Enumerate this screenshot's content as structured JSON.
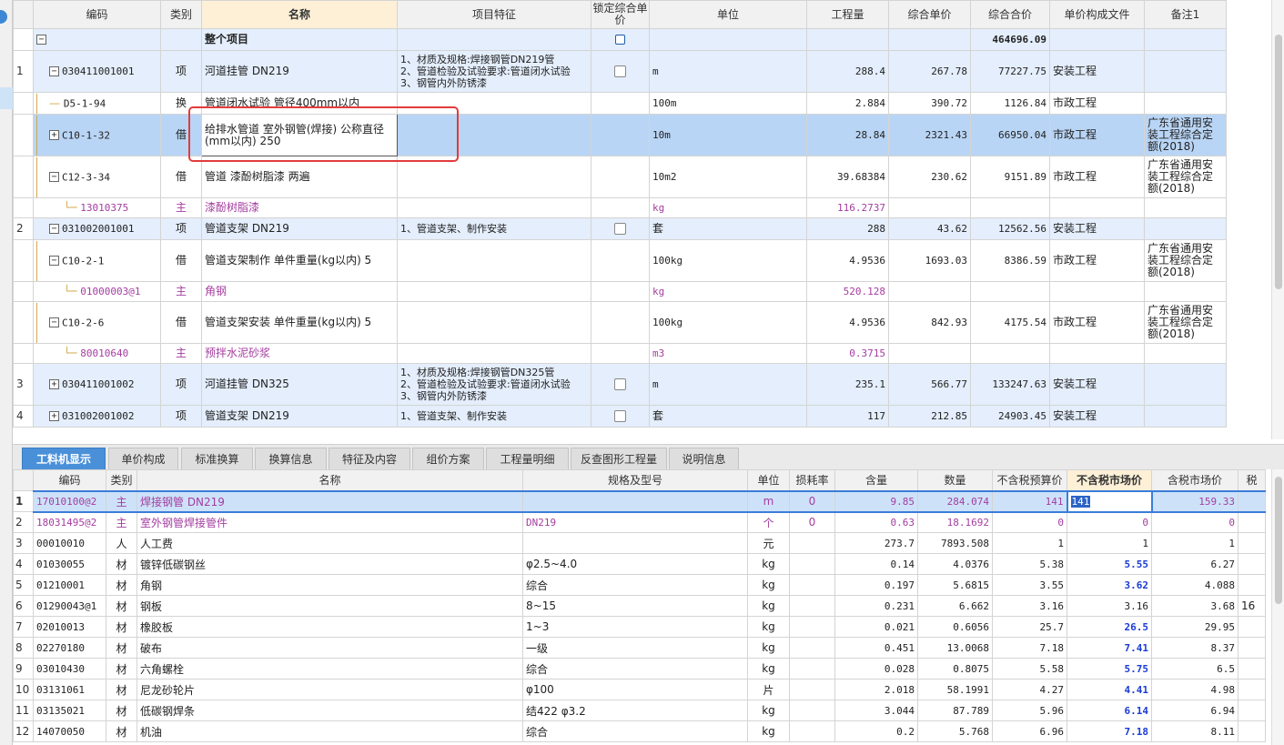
{
  "top": {
    "headers": [
      "",
      "编码",
      "类别",
      "名称",
      "项目特征",
      "锁定综合单价",
      "单位",
      "工程量",
      "综合单价",
      "综合合价",
      "单价构成文件",
      "备注1"
    ],
    "root": {
      "label": "整个项目",
      "total": "464696.09"
    },
    "rows": [
      {
        "no": "1",
        "code": "030411001001",
        "type": "项",
        "name": "河道挂管 DN219",
        "feat": [
          "1、材质及规格:焊接钢管DN219管",
          "2、管道检验及试验要求:管道闭水试验",
          "3、钢管内外防锈漆"
        ],
        "unit": "m",
        "qty": "288.4",
        "price": "267.78",
        "total": "77227.75",
        "file": "安装工程",
        "note": ""
      },
      {
        "no": "",
        "code": "D5-1-94",
        "type": "换",
        "name": "管道闭水试验 管径400mm以内",
        "feat": [],
        "unit": "100m",
        "qty": "2.884",
        "price": "390.72",
        "total": "1126.84",
        "file": "市政工程",
        "note": ""
      },
      {
        "no": "",
        "code": "C10-1-32",
        "type": "借",
        "name": "给排水管道 室外钢管(焊接) 公称直径(mm以内) 250",
        "feat": [],
        "unit": "10m",
        "qty": "28.84",
        "price": "2321.43",
        "total": "66950.04",
        "file": "市政工程",
        "note": "广东省通用安装工程综合定额(2018)"
      },
      {
        "no": "",
        "code": "C12-3-34",
        "type": "借",
        "name": "管道 漆酚树脂漆 两遍",
        "feat": [],
        "unit": "10m2",
        "qty": "39.68384",
        "price": "230.62",
        "total": "9151.89",
        "file": "市政工程",
        "note": "广东省通用安装工程综合定额(2018)"
      },
      {
        "no": "",
        "code": "13010375",
        "type": "主",
        "name": "漆酚树脂漆",
        "feat": [],
        "unit": "kg",
        "qty": "116.2737",
        "price": "",
        "total": "",
        "file": "",
        "note": ""
      },
      {
        "no": "2",
        "code": "031002001001",
        "type": "项",
        "name": "管道支架 DN219",
        "feat": [
          "1、管道支架、制作安装"
        ],
        "unit": "套",
        "qty": "288",
        "price": "43.62",
        "total": "12562.56",
        "file": "安装工程",
        "note": ""
      },
      {
        "no": "",
        "code": "C10-2-1",
        "type": "借",
        "name": "管道支架制作 单件重量(kg以内) 5",
        "feat": [],
        "unit": "100kg",
        "qty": "4.9536",
        "price": "1693.03",
        "total": "8386.59",
        "file": "市政工程",
        "note": "广东省通用安装工程综合定额(2018)"
      },
      {
        "no": "",
        "code": "01000003@1",
        "type": "主",
        "name": "角钢",
        "feat": [],
        "unit": "kg",
        "qty": "520.128",
        "price": "",
        "total": "",
        "file": "",
        "note": ""
      },
      {
        "no": "",
        "code": "C10-2-6",
        "type": "借",
        "name": "管道支架安装 单件重量(kg以内) 5",
        "feat": [],
        "unit": "100kg",
        "qty": "4.9536",
        "price": "842.93",
        "total": "4175.54",
        "file": "市政工程",
        "note": "广东省通用安装工程综合定额(2018)"
      },
      {
        "no": "",
        "code": "80010640",
        "type": "主",
        "name": "预拌水泥砂浆",
        "feat": [],
        "unit": "m3",
        "qty": "0.3715",
        "price": "",
        "total": "",
        "file": "",
        "note": ""
      },
      {
        "no": "3",
        "code": "030411001002",
        "type": "项",
        "name": "河道挂管 DN325",
        "feat": [
          "1、材质及规格:焊接钢管DN325管",
          "2、管道检验及试验要求:管道闭水试验",
          "3、钢管内外防锈漆"
        ],
        "unit": "m",
        "qty": "235.1",
        "price": "566.77",
        "total": "133247.63",
        "file": "安装工程",
        "note": ""
      },
      {
        "no": "4",
        "code": "031002001002",
        "type": "项",
        "name": "管道支架 DN219",
        "feat": [
          "1、管道支架、制作安装"
        ],
        "unit": "套",
        "qty": "117",
        "price": "212.85",
        "total": "24903.45",
        "file": "安装工程",
        "note": ""
      }
    ]
  },
  "tabs": [
    "工料机显示",
    "单价构成",
    "标准换算",
    "换算信息",
    "特征及内容",
    "组价方案",
    "工程量明细",
    "反查图形工程量",
    "说明信息"
  ],
  "bottom": {
    "headers": [
      "",
      "编码",
      "类别",
      "名称",
      "规格及型号",
      "单位",
      "损耗率",
      "含量",
      "数量",
      "不含税预算价",
      "不含税市场价",
      "含税市场价",
      "税"
    ],
    "rows": [
      {
        "no": "1",
        "code": "17010100@2",
        "type": "主",
        "name": "焊接钢管 DN219",
        "spec": "",
        "unit": "m",
        "loss": "0",
        "content": "9.85",
        "qty": "284.074",
        "budget": "141",
        "market": "141",
        "tax": "159.33",
        "extra": ""
      },
      {
        "no": "2",
        "code": "18031495@2",
        "type": "主",
        "name": "室外钢管焊接管件",
        "spec": "DN219",
        "unit": "个",
        "loss": "0",
        "content": "0.63",
        "qty": "18.1692",
        "budget": "0",
        "market": "0",
        "tax": "0",
        "extra": ""
      },
      {
        "no": "3",
        "code": "00010010",
        "type": "人",
        "name": "人工费",
        "spec": "",
        "unit": "元",
        "loss": "",
        "content": "273.7",
        "qty": "7893.508",
        "budget": "1",
        "market": "1",
        "tax": "1",
        "extra": ""
      },
      {
        "no": "4",
        "code": "01030055",
        "type": "材",
        "name": "镀锌低碳钢丝",
        "spec": "φ2.5~4.0",
        "unit": "kg",
        "loss": "",
        "content": "0.14",
        "qty": "4.0376",
        "budget": "5.38",
        "market": "5.55",
        "tax": "6.27",
        "extra": ""
      },
      {
        "no": "5",
        "code": "01210001",
        "type": "材",
        "name": "角钢",
        "spec": "综合",
        "unit": "kg",
        "loss": "",
        "content": "0.197",
        "qty": "5.6815",
        "budget": "3.55",
        "market": "3.62",
        "tax": "4.088",
        "extra": ""
      },
      {
        "no": "6",
        "code": "01290043@1",
        "type": "材",
        "name": "钢板",
        "spec": "8~15",
        "unit": "kg",
        "loss": "",
        "content": "0.231",
        "qty": "6.662",
        "budget": "3.16",
        "market": "3.16",
        "tax": "3.68",
        "extra": "16"
      },
      {
        "no": "7",
        "code": "02010013",
        "type": "材",
        "name": "橡胶板",
        "spec": "1~3",
        "unit": "kg",
        "loss": "",
        "content": "0.021",
        "qty": "0.6056",
        "budget": "25.7",
        "market": "26.5",
        "tax": "29.95",
        "extra": ""
      },
      {
        "no": "8",
        "code": "02270180",
        "type": "材",
        "name": "破布",
        "spec": "一级",
        "unit": "kg",
        "loss": "",
        "content": "0.451",
        "qty": "13.0068",
        "budget": "7.18",
        "market": "7.41",
        "tax": "8.37",
        "extra": ""
      },
      {
        "no": "9",
        "code": "03010430",
        "type": "材",
        "name": "六角螺栓",
        "spec": "综合",
        "unit": "kg",
        "loss": "",
        "content": "0.028",
        "qty": "0.8075",
        "budget": "5.58",
        "market": "5.75",
        "tax": "6.5",
        "extra": ""
      },
      {
        "no": "10",
        "code": "03131061",
        "type": "材",
        "name": "尼龙砂轮片",
        "spec": "φ100",
        "unit": "片",
        "loss": "",
        "content": "2.018",
        "qty": "58.1991",
        "budget": "4.27",
        "market": "4.41",
        "tax": "4.98",
        "extra": ""
      },
      {
        "no": "11",
        "code": "03135021",
        "type": "材",
        "name": "低碳钢焊条",
        "spec": "结422 φ3.2",
        "unit": "kg",
        "loss": "",
        "content": "3.044",
        "qty": "87.789",
        "budget": "5.96",
        "market": "6.14",
        "tax": "6.94",
        "extra": ""
      },
      {
        "no": "12",
        "code": "14070050",
        "type": "材",
        "name": "机油",
        "spec": "综合",
        "unit": "kg",
        "loss": "",
        "content": "0.2",
        "qty": "5.768",
        "budget": "6.96",
        "market": "7.18",
        "tax": "8.11",
        "extra": ""
      }
    ]
  }
}
